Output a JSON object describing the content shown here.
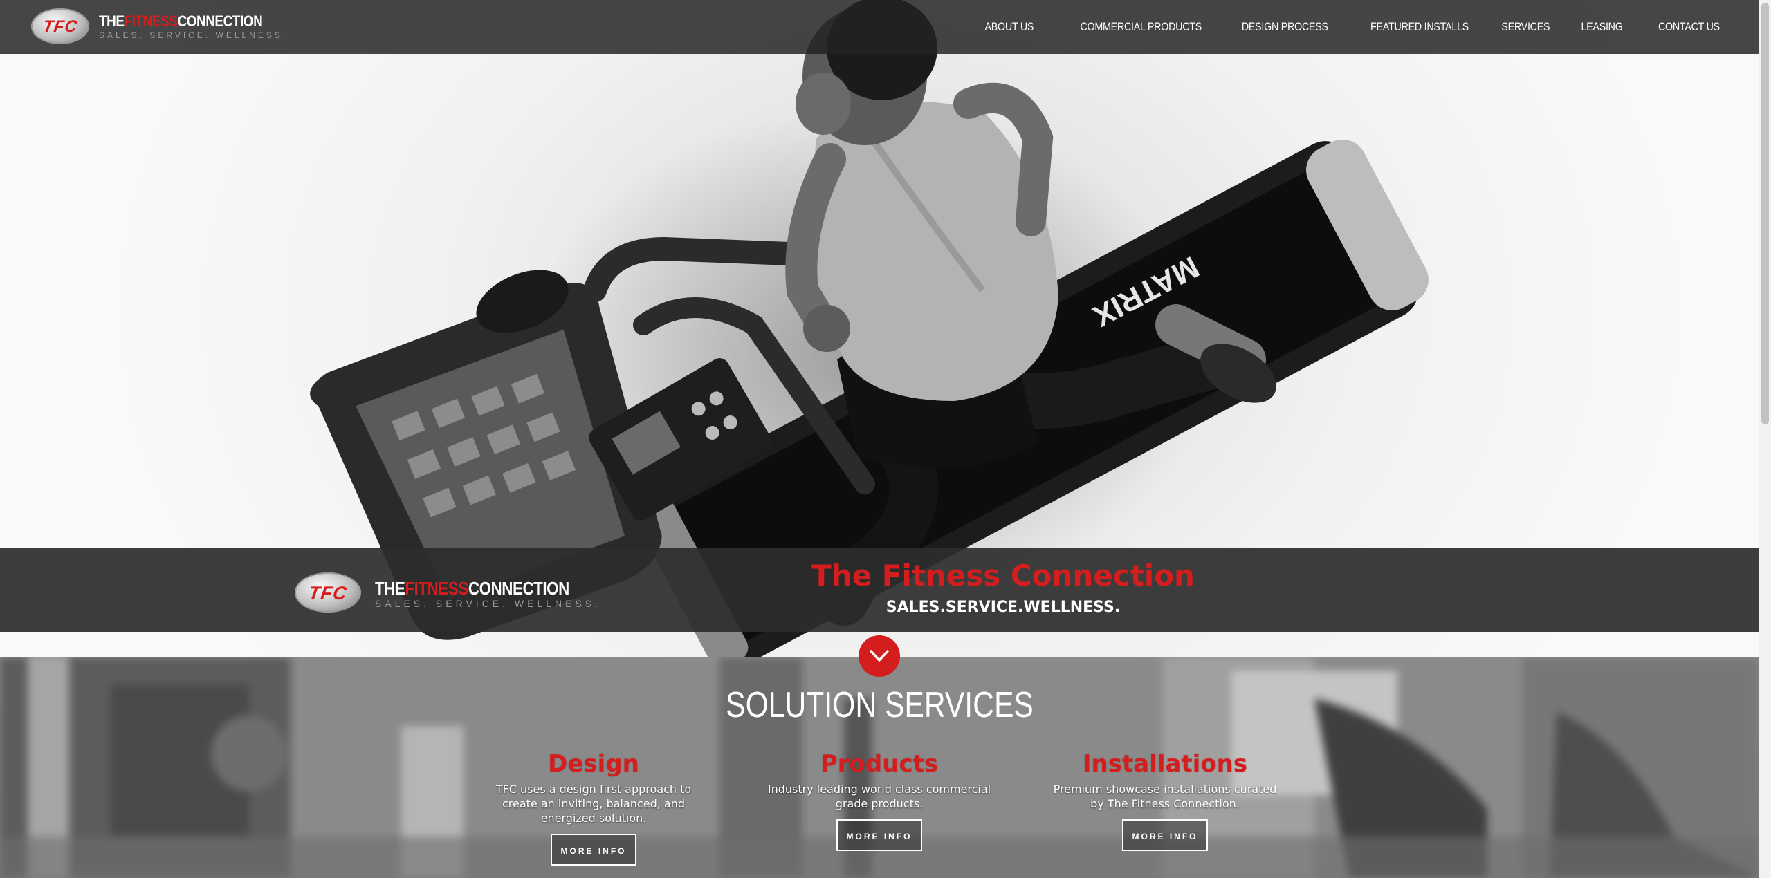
{
  "brand": {
    "logo_badge": "TFC",
    "logo_name_a": "THE",
    "logo_name_b": "FITNESS",
    "logo_name_c": "CONNECTION",
    "logo_tagline": "SALES. SERVICE. WELLNESS."
  },
  "nav": {
    "items": [
      {
        "label": "ABOUT US"
      },
      {
        "label": "COMMERCIAL PRODUCTS"
      },
      {
        "label": "DESIGN PROCESS"
      },
      {
        "label": "FEATURED INSTALLS"
      },
      {
        "label": "SERVICES"
      },
      {
        "label": "LEASING"
      },
      {
        "label": "CONTACT US"
      }
    ]
  },
  "hero": {
    "title": "The Fitness Connection",
    "subtitle": "SALES.SERVICE.WELLNESS.",
    "scroll_icon": "chevron-down-icon",
    "equipment_text": "MATRIX"
  },
  "services": {
    "title": "SOLUTION SERVICES",
    "items": [
      {
        "title": "Design",
        "description": "TFC uses a design first approach to create an inviting, balanced, and energized solution.",
        "button": "MORE INFO"
      },
      {
        "title": "Products",
        "description": "Industry leading world class commercial grade products.",
        "button": "MORE INFO"
      },
      {
        "title": "Installations",
        "description": "Premium showcase installations curated by The Fitness Connection.",
        "button": "MORE INFO"
      }
    ]
  },
  "colors": {
    "accent": "#d41d1d",
    "header_bg": "#232323",
    "text_light": "#ffffff"
  }
}
